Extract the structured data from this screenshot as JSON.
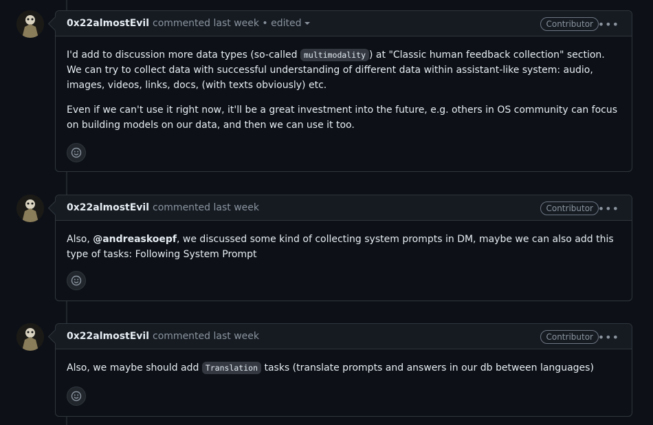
{
  "comments": [
    {
      "author": "0x22almostEvil",
      "meta": "commented last week • edited",
      "badge": "Contributor",
      "p1_a": "I'd add to discussion more data types (so-called ",
      "p1_code": "multimodality",
      "p1_b": ") at \"Classic human feedback collection\" section. We can try to collect data with successful understanding of different data within assistant-like system: audio, images, videos, links, docs, (with texts obviously) etc.",
      "p2": "Even if we can't use it right now, it'll be a great investment into the future, e.g. others in OS community can focus on building models on our data, and then we can use it too."
    },
    {
      "author": "0x22almostEvil",
      "meta": "commented last week",
      "badge": "Contributor",
      "p1_a": "Also, ",
      "mention": "@andreaskoepf",
      "p1_b": ", we discussed some kind of collecting system prompts in DM, maybe we can also add this type of tasks: Following System Prompt"
    },
    {
      "author": "0x22almostEvil",
      "meta": "commented last week",
      "badge": "Contributor",
      "p1_a": "Also, we maybe should add ",
      "p1_code": "Translation",
      "p1_b": " tasks (translate prompts and answers in our db between languages)"
    }
  ]
}
